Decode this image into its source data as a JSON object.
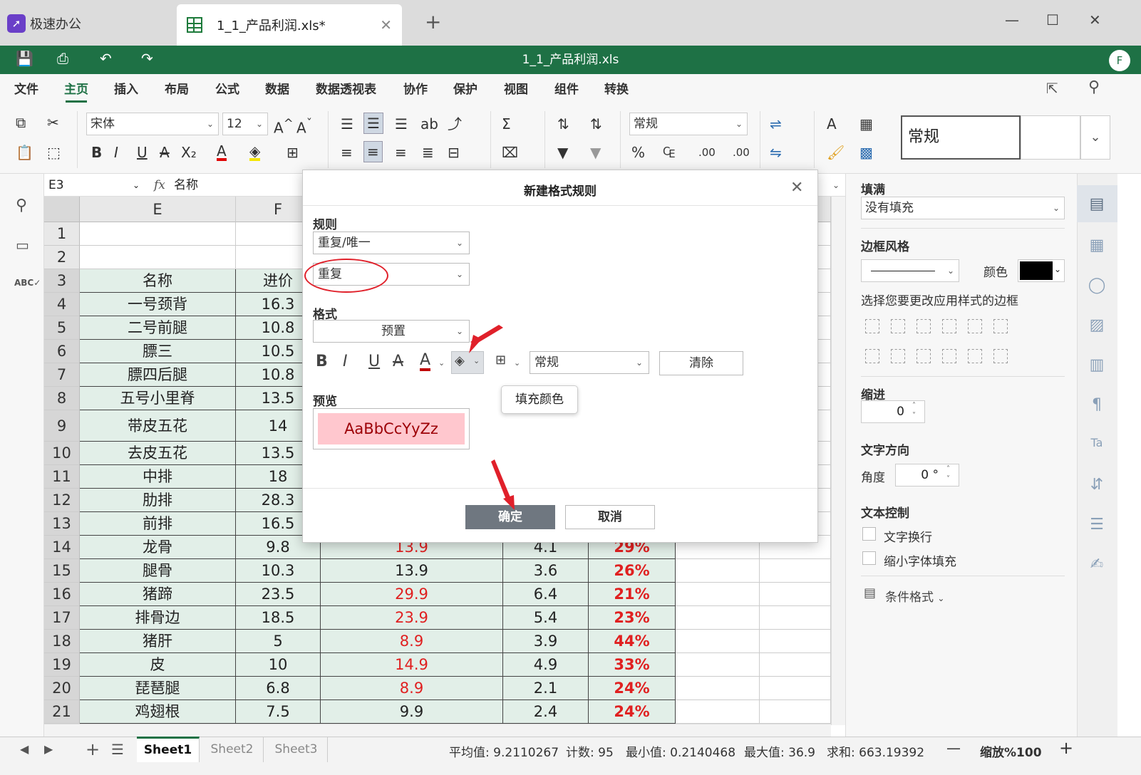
{
  "app": {
    "name": "极速办公",
    "tab_title": "1_1_产品利润.xls*",
    "doc_title": "1_1_产品利润.xls",
    "user_initial": "F"
  },
  "menu": [
    "文件",
    "主页",
    "插入",
    "布局",
    "公式",
    "数据",
    "数据透视表",
    "协作",
    "保护",
    "视图",
    "组件",
    "转换"
  ],
  "menu_active": "主页",
  "ribbon": {
    "font_name": "宋体",
    "font_size": "12",
    "number_format": "常规",
    "style_box": "常规"
  },
  "formula_bar": {
    "cell_ref": "E3",
    "fx": "fx",
    "content": "名称"
  },
  "grid": {
    "columns": [
      "E",
      "F"
    ],
    "rows": [
      {
        "n": "1",
        "name": "",
        "cost": "",
        "price": "",
        "profit": "",
        "rate": ""
      },
      {
        "n": "2",
        "name": "",
        "cost": "",
        "price": "",
        "profit": "",
        "rate": ""
      },
      {
        "n": "3",
        "name": "名称",
        "cost": "进价",
        "price": "",
        "profit": "",
        "rate": ""
      },
      {
        "n": "4",
        "name": "一号颈背",
        "cost": "16.3",
        "price": "",
        "profit": "",
        "rate": ""
      },
      {
        "n": "5",
        "name": "二号前腿",
        "cost": "10.8",
        "price": "",
        "profit": "",
        "rate": ""
      },
      {
        "n": "6",
        "name": "膘三",
        "cost": "10.5",
        "price": "",
        "profit": "",
        "rate": ""
      },
      {
        "n": "7",
        "name": "膘四后腿",
        "cost": "10.8",
        "price": "",
        "profit": "",
        "rate": ""
      },
      {
        "n": "8",
        "name": "五号小里脊",
        "cost": "13.5",
        "price": "",
        "profit": "",
        "rate": ""
      },
      {
        "n": "9",
        "name": "带皮五花",
        "cost": "14",
        "price": "",
        "profit": "",
        "rate": ""
      },
      {
        "n": "10",
        "name": "去皮五花",
        "cost": "13.5",
        "price": "",
        "profit": "",
        "rate": ""
      },
      {
        "n": "11",
        "name": "中排",
        "cost": "18",
        "price": "",
        "profit": "",
        "rate": ""
      },
      {
        "n": "12",
        "name": "肋排",
        "cost": "28.3",
        "price": "",
        "profit": "",
        "rate": ""
      },
      {
        "n": "13",
        "name": "前排",
        "cost": "16.5",
        "price": "",
        "profit": "",
        "rate": ""
      },
      {
        "n": "14",
        "name": "龙骨",
        "cost": "9.8",
        "price": "13.9",
        "profit": "4.1",
        "rate": "29%"
      },
      {
        "n": "15",
        "name": "腿骨",
        "cost": "10.3",
        "price": "13.9",
        "profit": "3.6",
        "rate": "26%"
      },
      {
        "n": "16",
        "name": "猪蹄",
        "cost": "23.5",
        "price": "29.9",
        "profit": "6.4",
        "rate": "21%"
      },
      {
        "n": "17",
        "name": "排骨边",
        "cost": "18.5",
        "price": "23.9",
        "profit": "5.4",
        "rate": "23%"
      },
      {
        "n": "18",
        "name": "猪肝",
        "cost": "5",
        "price": "8.9",
        "profit": "3.9",
        "rate": "44%"
      },
      {
        "n": "19",
        "name": "皮",
        "cost": "10",
        "price": "14.9",
        "profit": "4.9",
        "rate": "33%"
      },
      {
        "n": "20",
        "name": "琵琶腿",
        "cost": "6.8",
        "price": "8.9",
        "profit": "2.1",
        "rate": "24%"
      },
      {
        "n": "21",
        "name": "鸡翅根",
        "cost": "7.5",
        "price": "9.9",
        "profit": "2.4",
        "rate": "24%"
      }
    ]
  },
  "dialog": {
    "title": "新建格式规则",
    "rule_label": "规则",
    "rule_value": "重复/唯一",
    "rule_sub_value": "重复",
    "format_label": "格式",
    "preset_value": "预置",
    "number_format": "常规",
    "clear_button": "清除",
    "tooltip": "填充颜色",
    "preview_label": "预览",
    "preview_text": "AaBbCcYyZz",
    "ok_button": "确定",
    "cancel_button": "取消"
  },
  "right_panel": {
    "fill_label": "填满",
    "fill_value": "没有填充",
    "border_style_label": "边框风格",
    "color_label": "颜色",
    "border_hint": "选择您要更改应用样式的边框",
    "indent_label": "缩进",
    "indent_value": "0",
    "text_dir_label": "文字方向",
    "angle_label": "角度",
    "angle_value": "0 °",
    "text_control_label": "文本控制",
    "wrap_label": "文字换行",
    "shrink_label": "缩小字体填充",
    "cond_format_label": "条件格式"
  },
  "status": {
    "sheets": [
      "Sheet1",
      "Sheet2",
      "Sheet3"
    ],
    "active_sheet": "Sheet1",
    "average": "平均值: 9.2110267",
    "count": "计数: 95",
    "min": "最小值: 0.2140468",
    "max": "最大值: 36.9",
    "sum": "求和: 663.19392",
    "zoom": "缩放%100"
  },
  "colors": {
    "brand": "#1e7145",
    "accent_red": "#e02020",
    "preview_bg": "#ffc7ce",
    "preview_fg": "#9c0006"
  }
}
